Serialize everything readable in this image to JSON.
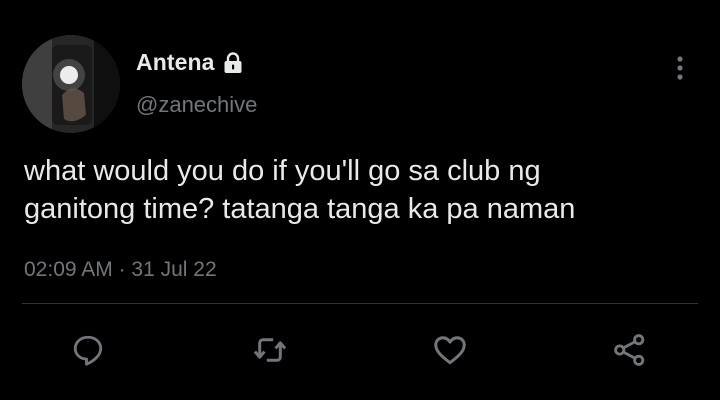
{
  "tweet": {
    "author": {
      "display_name": "Antena",
      "handle": "@zanechive",
      "protected_icon": "lock-icon",
      "avatar": "profile-photo"
    },
    "text": "what would you do if you'll go sa club ng\nganitong time? tatanga tanga ka pa naman",
    "time": "02:09 AM",
    "separator": "·",
    "date": "31 Jul 22",
    "more_icon": "more-vertical-icon",
    "actions": [
      {
        "name": "reply",
        "icon": "reply-icon"
      },
      {
        "name": "retweet",
        "icon": "retweet-icon"
      },
      {
        "name": "like",
        "icon": "heart-icon"
      },
      {
        "name": "share",
        "icon": "share-icon"
      }
    ]
  },
  "colors": {
    "background": "#000000",
    "primary_text": "#e7e9ea",
    "secondary_text": "#71767b",
    "divider": "#2f3336"
  }
}
